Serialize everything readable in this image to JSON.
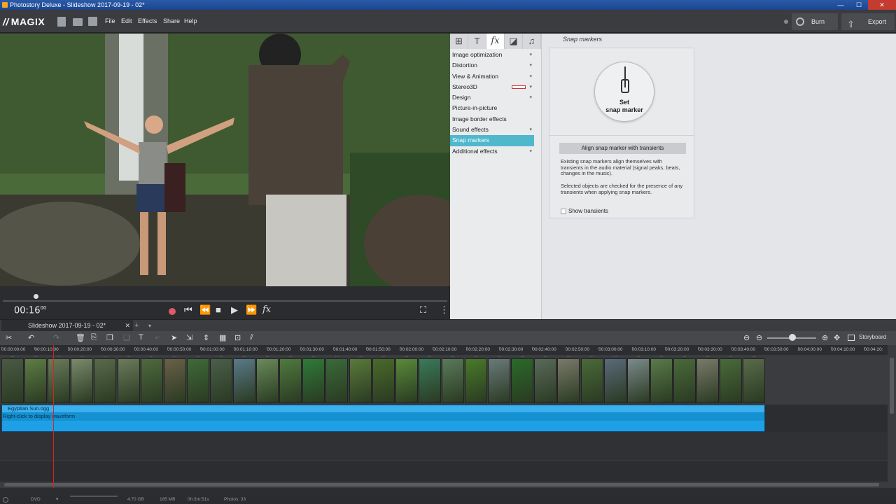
{
  "window": {
    "title": "Photostory Deluxe - Slideshow 2017-09-19 - 02*",
    "min": "—",
    "max": "☐",
    "close": "✕"
  },
  "brand": {
    "logo": "MAGIX",
    "mark": "//"
  },
  "menu": {
    "items": [
      "File",
      "Edit",
      "Effects",
      "Share",
      "Help"
    ]
  },
  "actions": {
    "burn": "Burn",
    "export": "Export"
  },
  "player": {
    "timecode": "00:16",
    "frames": "00"
  },
  "effect_tabs": [
    {
      "icon": "media-grid-icon",
      "glyph": "⊞"
    },
    {
      "icon": "text-icon",
      "glyph": "T"
    },
    {
      "icon": "fx-icon",
      "glyph": "fx"
    },
    {
      "icon": "transition-icon",
      "glyph": "◪"
    },
    {
      "icon": "music-icon",
      "glyph": "♫"
    }
  ],
  "effects_list": [
    {
      "label": "Image optimization",
      "chevron": true
    },
    {
      "label": "Distortion",
      "chevron": true
    },
    {
      "label": "View & Animation",
      "chevron": true
    },
    {
      "label": "Stereo3D",
      "chevron": true
    },
    {
      "label": "Design",
      "chevron": true
    },
    {
      "label": "Picture-in-picture",
      "chevron": false
    },
    {
      "label": "Image border effects",
      "chevron": false
    },
    {
      "label": "Sound effects",
      "chevron": true
    },
    {
      "label": "Snap markers",
      "chevron": false,
      "selected": true
    },
    {
      "label": "Additional effects",
      "chevron": true
    }
  ],
  "snap_panel": {
    "title": "Snap markers",
    "set_line1": "Set",
    "set_line2": "snap marker",
    "align_button": "Align snap marker with transients",
    "desc1": "Existing snap markers align themselves with transients in the audio material (signal peaks, beats, changes in the music).",
    "desc2": "Selected objects are checked for the presence of any transients when applying snap markers.",
    "show_transients": "Show transients",
    "show_transients_checked": false
  },
  "project_tab": {
    "name": "Slideshow 2017-09-19 - 02*",
    "close": "✕",
    "add": "+",
    "dropdown": "▾"
  },
  "timeline": {
    "ruler": [
      "00:00:00:00",
      "00:00:10:00",
      "00:00:20:00",
      "00:00:30:00",
      "00:00:40:00",
      "00:00:50:00",
      "00:01:00:00",
      "00:01:10:00",
      "00:01:20:00",
      "00:01:30:00",
      "00:01:40:00",
      "00:01:50:00",
      "00:02:00:00",
      "00:02:10:00",
      "00:02:20:00",
      "00:02:30:00",
      "00:02:40:00",
      "00:02:50:00",
      "00:03:00:00",
      "00:03:10:00",
      "00:03:20:00",
      "00:03:30:00",
      "00:03:40:00",
      "00:03:50:00",
      "00:04:00:00",
      "00:04:10:00",
      "00:04:20:"
    ],
    "storyboard": "Storyboard",
    "audio_name": "Egyptian Sun.ogg",
    "audio_hint": "Right-click to display waveform",
    "photo_colors": [
      "#4a5a44",
      "#5f7d45",
      "#6a7a5a",
      "#7a8a6a",
      "#5a6a4a",
      "#6b7b5b",
      "#4f6a3f",
      "#6a6048",
      "#3f6a3a",
      "#4a5f4a",
      "#5a7a8a",
      "#6a8a5a",
      "#4f7a3f",
      "#2f7a3a",
      "#3a6a3a",
      "#5a7a3a",
      "#4a6a2a",
      "#5a8a3a",
      "#3a7a5a",
      "#5a7a5a",
      "#4a7a2a",
      "#6a7a7a",
      "#2a6a2a",
      "#5a6a5a",
      "#7a7a6a",
      "#4a6a3a",
      "#5a6a7a",
      "#7a8a8a",
      "#5a7a4a",
      "#4a6a3a",
      "#7a7a6a",
      "#4a6a3a",
      "#5a6a4a"
    ]
  },
  "status": {
    "disc": "DVD",
    "size": "4.70 GB",
    "used": "185 MB",
    "duration": "0h:3m:51s",
    "photos": "Photos: 33"
  }
}
